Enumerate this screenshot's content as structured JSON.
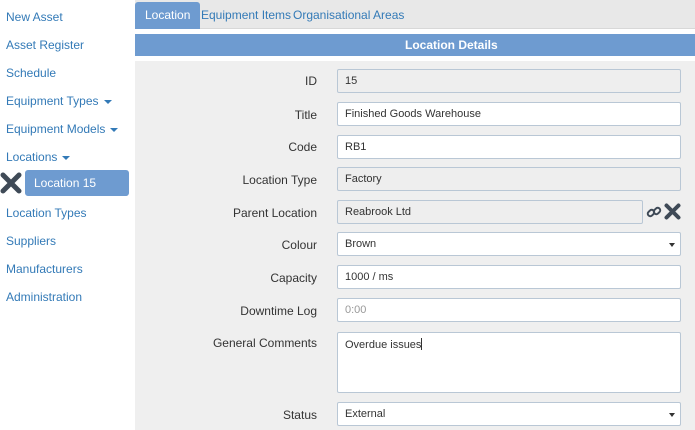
{
  "sidebar": {
    "items": [
      {
        "label": "New Asset"
      },
      {
        "label": "Asset Register"
      },
      {
        "label": "Schedule"
      },
      {
        "label": "Equipment Types"
      },
      {
        "label": "Equipment Models"
      },
      {
        "label": "Locations"
      },
      {
        "label": "Location Types"
      },
      {
        "label": "Suppliers"
      },
      {
        "label": "Manufacturers"
      },
      {
        "label": "Administration"
      }
    ],
    "active_item": "Location 15"
  },
  "tabs": [
    {
      "label": "Location"
    },
    {
      "label": "Equipment Items"
    },
    {
      "label": "Organisational Areas"
    }
  ],
  "panel": {
    "title": "Location Details"
  },
  "form": {
    "id": {
      "label": "ID",
      "value": "15"
    },
    "title": {
      "label": "Title",
      "value": "Finished Goods Warehouse"
    },
    "code": {
      "label": "Code",
      "value": "RB1"
    },
    "location_type": {
      "label": "Location Type",
      "value": "Factory"
    },
    "parent_location": {
      "label": "Parent Location",
      "value": "Reabrook Ltd"
    },
    "colour": {
      "label": "Colour",
      "value": "Brown"
    },
    "capacity": {
      "label": "Capacity",
      "value": "1000 / ms"
    },
    "downtime_log": {
      "label": "Downtime Log",
      "placeholder": "0:00"
    },
    "general_comments": {
      "label": "General Comments",
      "value": "Overdue issues"
    },
    "status": {
      "label": "Status",
      "value": "External"
    }
  },
  "colors": {
    "accent": "#6e9bd0",
    "link": "#337ab7",
    "panel_bg": "#efefef",
    "x_icon": "#3f4a57"
  }
}
